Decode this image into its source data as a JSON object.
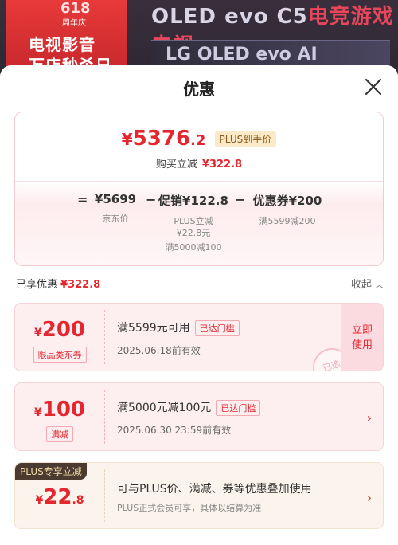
{
  "banner": {
    "badge_618": "618",
    "badge_anniv": "周年庆",
    "badge_line1": "电视影音",
    "badge_line2": "万店秒杀日",
    "title_prefix": "OLED evo C5",
    "title_suffix": "电竞游戏电视",
    "tv_text": "LG OLED evo AI"
  },
  "sheet": {
    "title": "优惠"
  },
  "summary": {
    "price_yen": "¥",
    "price_int": "5376",
    "price_dec": ".2",
    "plus_tag": "PLUS到手价",
    "sub_label": "购买立减",
    "sub_amount": "¥322.8",
    "formula": {
      "eq": "=",
      "base_value": "¥5699",
      "base_label": "京东价",
      "minus1": "−",
      "promo_value": "促销¥122.8",
      "promo_label_1": "PLUS立减",
      "promo_label_2": "¥22.8元",
      "promo_label_3": "满5000减100",
      "minus2": "−",
      "coupon_value": "优惠券¥200",
      "coupon_label": "满5599减200"
    }
  },
  "discounts": {
    "label": "已享优惠",
    "amount": "¥322.8",
    "collapse_label": "收起"
  },
  "coupons": [
    {
      "yen": "¥",
      "value": "200",
      "kind": "限品类东券",
      "title": "满5599元可用",
      "reach": "已达门槛",
      "date": "2025.06.18前有效",
      "action": "立即使用",
      "action_1": "立即",
      "action_2": "使用",
      "stamp": "已选"
    },
    {
      "yen": "¥",
      "value": "100",
      "kind": "满减",
      "title": "满5000元减100元",
      "reach": "已达门槛",
      "date": "2025.06.30 23:59前有效",
      "chevron": "›"
    },
    {
      "badge": "PLUS专享立减",
      "yen": "¥",
      "value_int": "22",
      "value_dec": ".8",
      "title": "可与PLUS价、满减、券等优惠叠加使用",
      "date": "PLUS正式会员可享，具体以结算为准",
      "chevron": "›"
    }
  ],
  "colors": {
    "accent": "#e4262f",
    "coupon_bg": "#fdeef0",
    "plus_bg": "#fbf4ec",
    "plus_badge": "#4a3a30"
  }
}
